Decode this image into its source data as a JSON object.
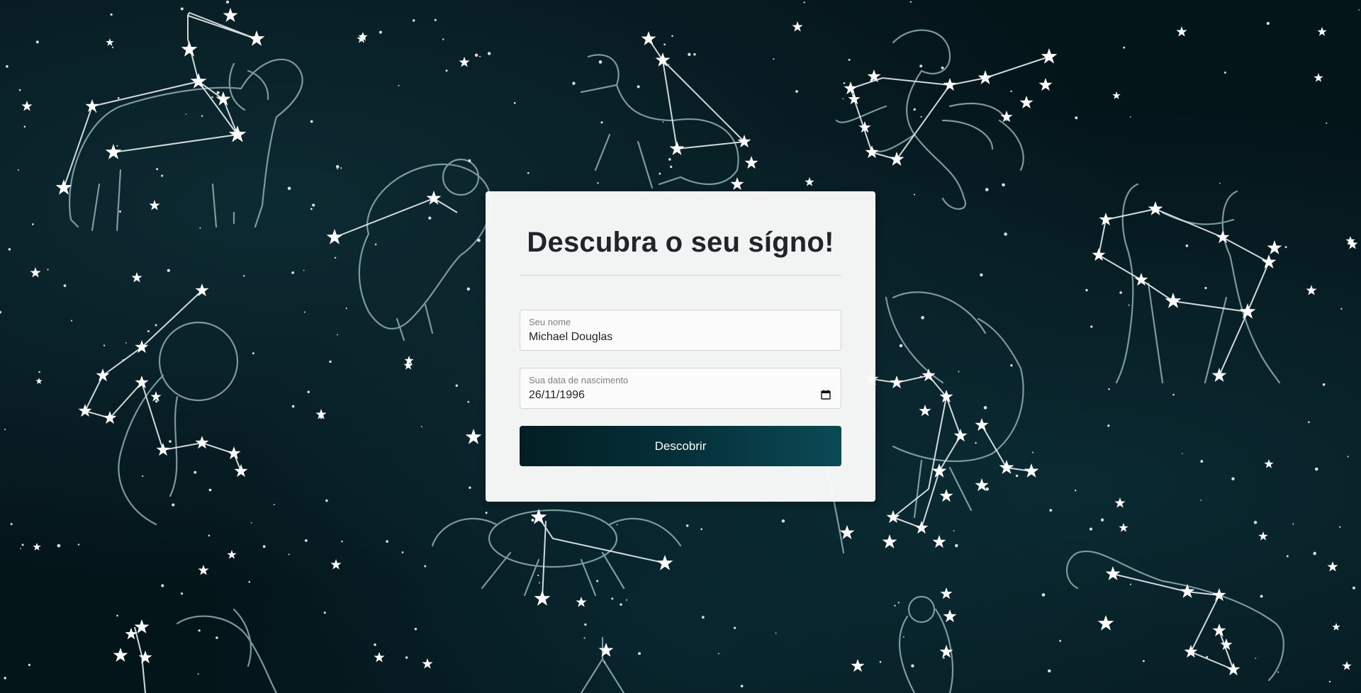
{
  "page": {
    "title": "Descubra o seu sígno!"
  },
  "form": {
    "name_field": {
      "label": "Seu nome",
      "value": "Michael Douglas"
    },
    "birthdate_field": {
      "label": "Sua data de nascimento",
      "value": "26/11/1996",
      "icon": "calendar-icon"
    },
    "submit_label": "Descobrir"
  },
  "background": {
    "theme": "zodiac-constellations",
    "sky_color": "#04151a",
    "art_color": "#8fb0b5",
    "star_color": "#ffffff"
  },
  "colors": {
    "button_dark": "#021e23",
    "button_light": "#0b4a55",
    "card_bg": "#fafafa",
    "text": "#212529"
  }
}
